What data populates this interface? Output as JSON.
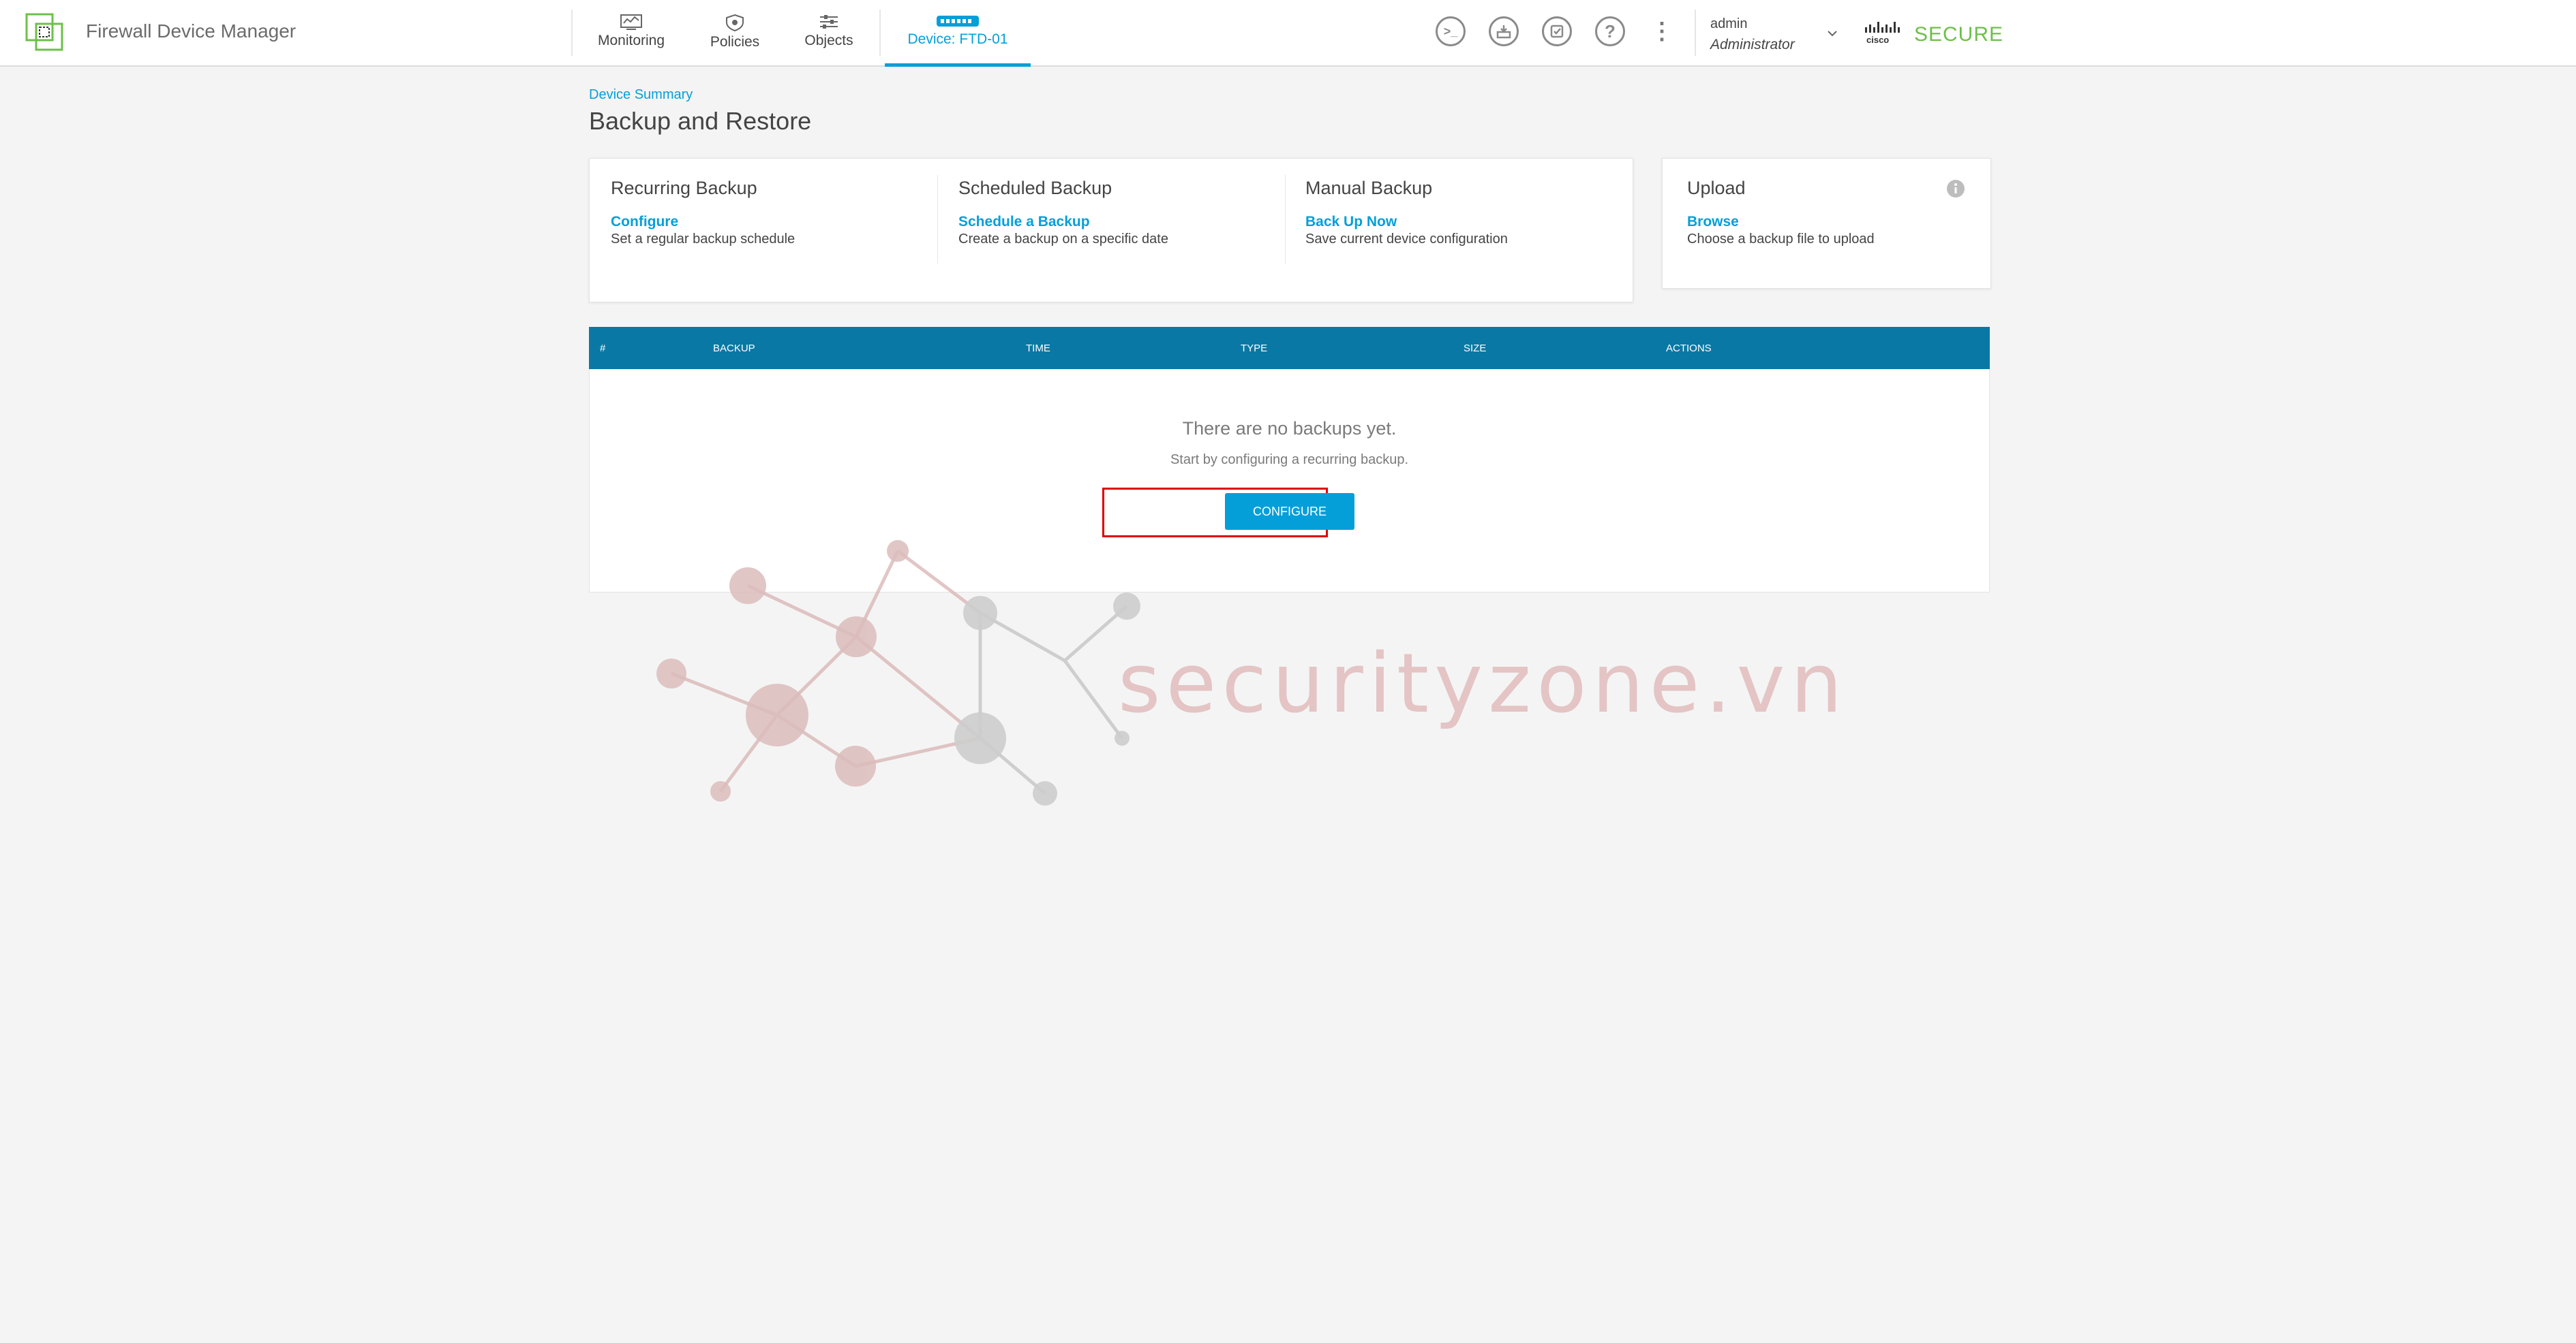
{
  "app": {
    "title": "Firewall Device Manager"
  },
  "nav": [
    {
      "label": "Monitoring",
      "icon": "monitoring-icon"
    },
    {
      "label": "Policies",
      "icon": "policies-icon"
    },
    {
      "label": "Objects",
      "icon": "objects-icon"
    },
    {
      "label": "Device: FTD-01",
      "icon": "device-icon",
      "active": true
    }
  ],
  "header_actions": [
    {
      "name": "cli-console",
      "icon": "terminal-icon",
      "glyph": ">_"
    },
    {
      "name": "deploy",
      "icon": "deploy-icon",
      "glyph": ""
    },
    {
      "name": "tasks",
      "icon": "task-list-icon",
      "glyph": ""
    },
    {
      "name": "help",
      "icon": "help-icon",
      "glyph": "?"
    },
    {
      "name": "more",
      "icon": "more-vertical-icon",
      "glyph": "⋮"
    }
  ],
  "user": {
    "name": "admin",
    "role": "Administrator"
  },
  "brand": {
    "vendor": "cisco",
    "product": "SECURE"
  },
  "breadcrumb": "Device Summary",
  "page_title": "Backup and Restore",
  "backup_options": [
    {
      "title": "Recurring Backup",
      "link": "Configure",
      "desc": "Set a regular backup schedule"
    },
    {
      "title": "Scheduled Backup",
      "link": "Schedule a Backup",
      "desc": "Create a backup on a specific date"
    },
    {
      "title": "Manual Backup",
      "link": "Back Up Now",
      "desc": "Save current device configuration"
    }
  ],
  "upload": {
    "title": "Upload",
    "link": "Browse",
    "desc": "Choose a backup file to upload",
    "info_icon": "info-icon"
  },
  "table": {
    "columns": [
      "#",
      "BACKUP",
      "TIME",
      "TYPE",
      "SIZE",
      "ACTIONS"
    ],
    "rows": [],
    "empty_title": "There are no backups yet.",
    "empty_subtitle": "Start by configuring a recurring backup.",
    "configure_label": "CONFIGURE"
  },
  "watermark": {
    "text": "securityzone.vn"
  },
  "colors": {
    "accent": "#049fd9",
    "table_header": "#0a78a4",
    "brand_green": "#6cc04a",
    "highlight": "#e00000"
  }
}
